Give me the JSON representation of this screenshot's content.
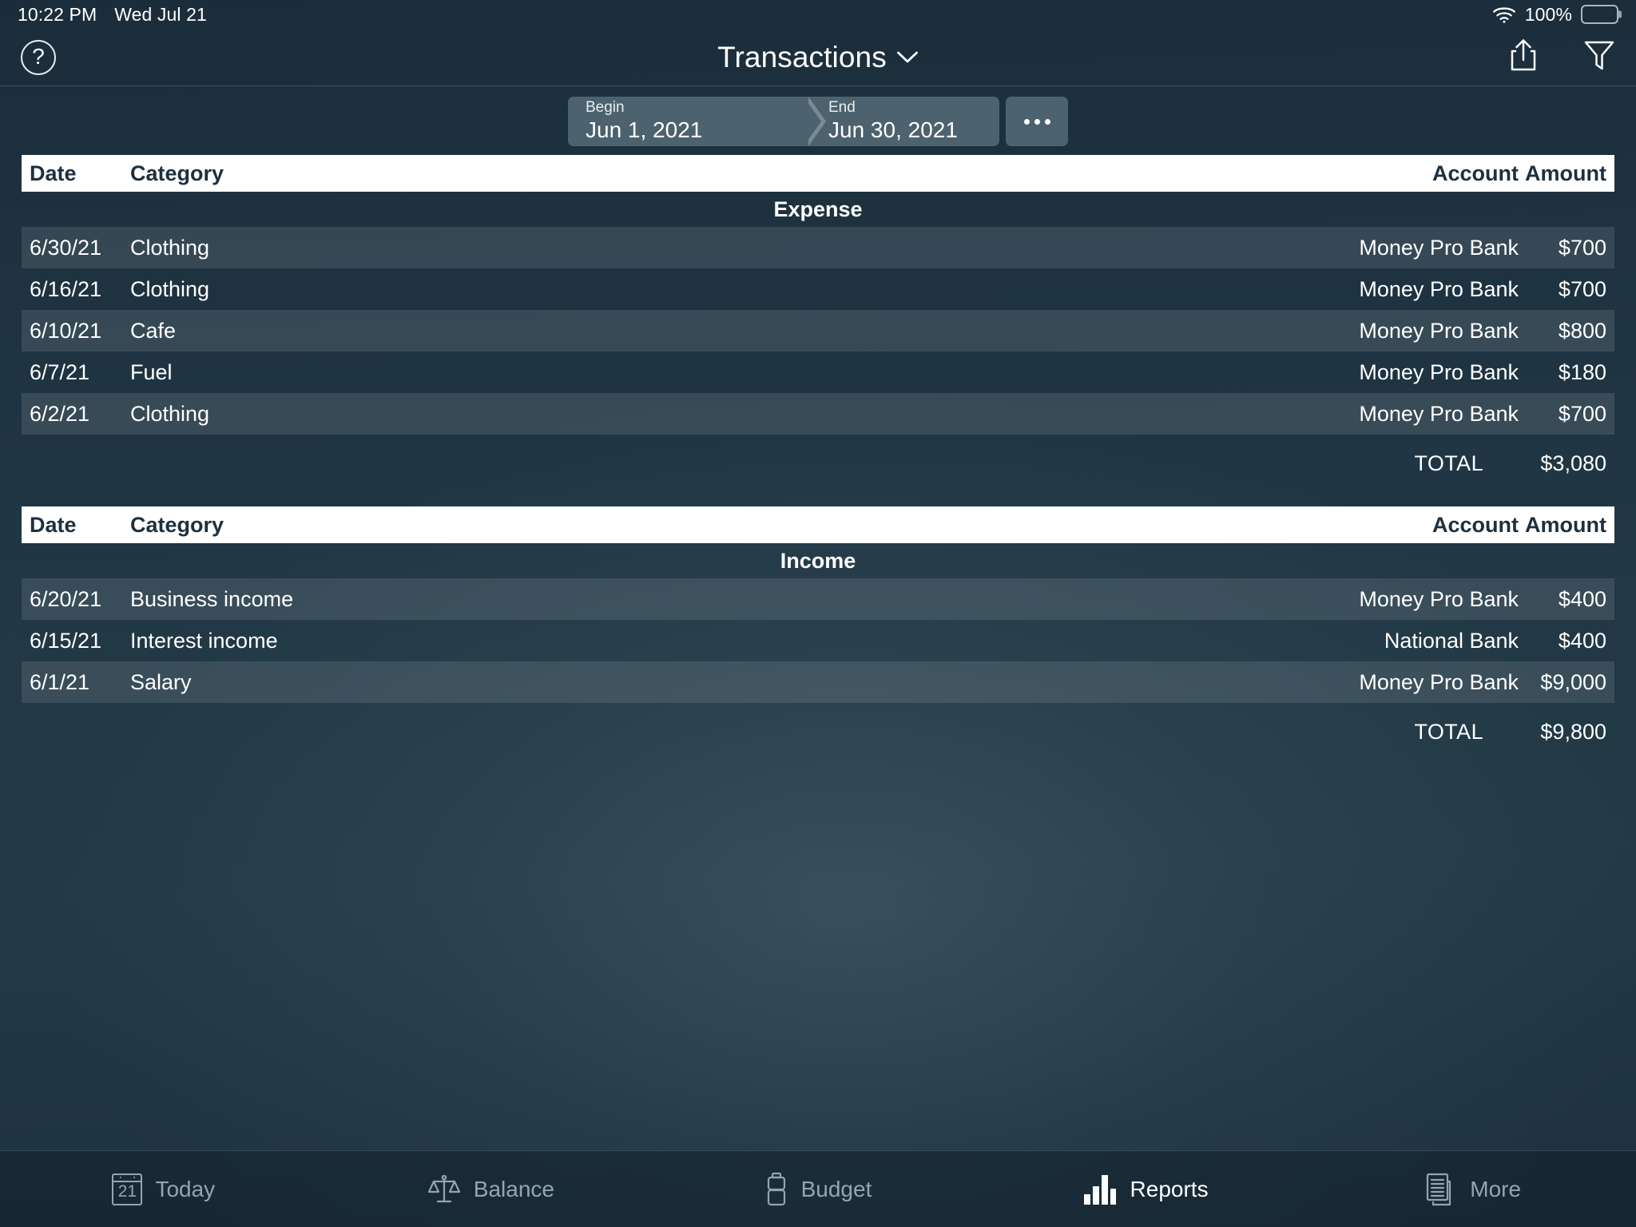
{
  "status_bar": {
    "time": "10:22 PM",
    "date": "Wed Jul 21",
    "battery_percent": "100%",
    "wifi_icon": "wifi-icon",
    "battery_icon": "battery-icon"
  },
  "nav": {
    "help_label": "?",
    "title": "Transactions",
    "chevron_icon": "chevron-down-icon",
    "share_icon": "share-icon",
    "filter_icon": "filter-icon"
  },
  "date_range": {
    "begin_label": "Begin",
    "begin_value": "Jun 1, 2021",
    "end_label": "End",
    "end_value": "Jun 30, 2021",
    "more_icon": "ellipsis-icon"
  },
  "columns": {
    "date": "Date",
    "category": "Category",
    "account": "Account",
    "amount": "Amount"
  },
  "expense": {
    "section_title": "Expense",
    "rows": [
      {
        "date": "6/30/21",
        "category": "Clothing",
        "account": "Money Pro Bank",
        "amount": "$700"
      },
      {
        "date": "6/16/21",
        "category": "Clothing",
        "account": "Money Pro Bank",
        "amount": "$700"
      },
      {
        "date": "6/10/21",
        "category": "Cafe",
        "account": "Money Pro Bank",
        "amount": "$800"
      },
      {
        "date": "6/7/21",
        "category": "Fuel",
        "account": "Money Pro Bank",
        "amount": "$180"
      },
      {
        "date": "6/2/21",
        "category": "Clothing",
        "account": "Money Pro Bank",
        "amount": "$700"
      }
    ],
    "total_label": "TOTAL",
    "total_value": "$3,080"
  },
  "income": {
    "section_title": "Income",
    "rows": [
      {
        "date": "6/20/21",
        "category": "Business income",
        "account": "Money Pro Bank",
        "amount": "$400"
      },
      {
        "date": "6/15/21",
        "category": "Interest income",
        "account": "National Bank",
        "amount": "$400"
      },
      {
        "date": "6/1/21",
        "category": "Salary",
        "account": "Money Pro Bank",
        "amount": "$9,000"
      }
    ],
    "total_label": "TOTAL",
    "total_value": "$9,800"
  },
  "tabs": [
    {
      "label": "Today",
      "icon": "calendar-icon",
      "day": "21",
      "active": false
    },
    {
      "label": "Balance",
      "icon": "scales-icon",
      "active": false
    },
    {
      "label": "Budget",
      "icon": "battery-icon",
      "active": false
    },
    {
      "label": "Reports",
      "icon": "bar-chart-icon",
      "active": true
    },
    {
      "label": "More",
      "icon": "documents-icon",
      "active": false
    }
  ],
  "colors": {
    "background": "#203440",
    "header_bar": "#ffffff",
    "header_text": "#1d3040",
    "row_alt": "rgba(255,255,255,0.11)",
    "segment": "#4c626e",
    "tab_inactive": "#93a6ae",
    "tab_active": "#ffffff"
  }
}
